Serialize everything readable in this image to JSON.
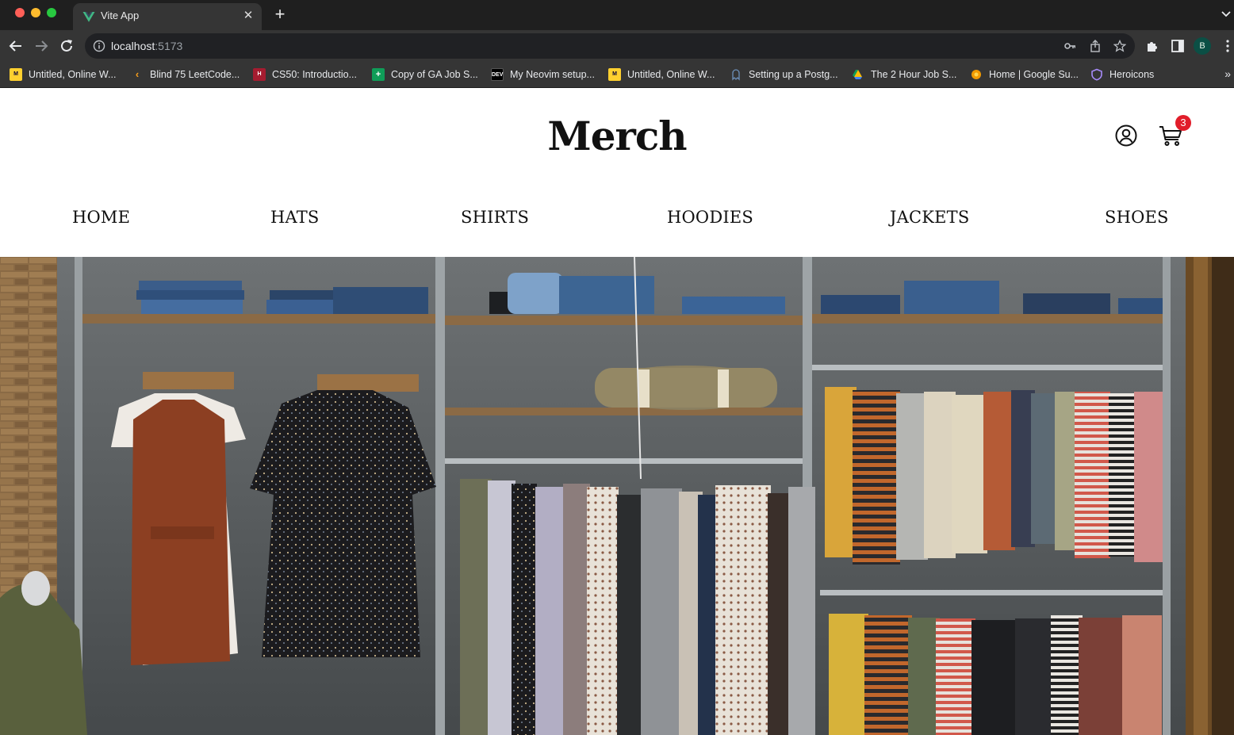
{
  "browser": {
    "tab_title": "Vite App",
    "tab_close_icon": "close-icon",
    "new_tab_icon": "plus-icon",
    "url_host": "localhost",
    "url_port": ":5173",
    "profile_initial": "B",
    "bookmarks": [
      {
        "label": "Untitled, Online W...",
        "icon": "miro-icon",
        "color": "#ffd02f"
      },
      {
        "label": "Blind 75 LeetCode...",
        "icon": "leetcode-icon",
        "color": "#f89f1b"
      },
      {
        "label": "CS50: Introductio...",
        "icon": "harvard-icon",
        "color": "#a51c30"
      },
      {
        "label": "Copy of GA Job S...",
        "icon": "sheets-icon",
        "color": "#0f9d58"
      },
      {
        "label": "My Neovim setup...",
        "icon": "dev-icon",
        "color": "#000000"
      },
      {
        "label": "Untitled, Online W...",
        "icon": "miro-icon",
        "color": "#ffd02f"
      },
      {
        "label": "Setting up a Postg...",
        "icon": "postgres-icon",
        "color": "#336791"
      },
      {
        "label": "The 2 Hour Job S...",
        "icon": "drive-icon",
        "color": "#fbbc04"
      },
      {
        "label": "Home | Google Su...",
        "icon": "gear-flower-icon",
        "color": "#f29900"
      },
      {
        "label": "Heroicons",
        "icon": "shield-icon",
        "color": "#8b5cf6"
      }
    ],
    "bookmarks_more": "»"
  },
  "header": {
    "brand": "Merch",
    "cart_count": "3",
    "account_icon": "user-circle-icon",
    "cart_icon": "shopping-cart-icon",
    "badge_color": "#e11d2a"
  },
  "nav": {
    "items": [
      "HOME",
      "HATS",
      "SHIRTS",
      "HOODIES",
      "JACKETS",
      "SHOES"
    ]
  },
  "hero": {
    "image": "clothing-store-racks-photo"
  }
}
